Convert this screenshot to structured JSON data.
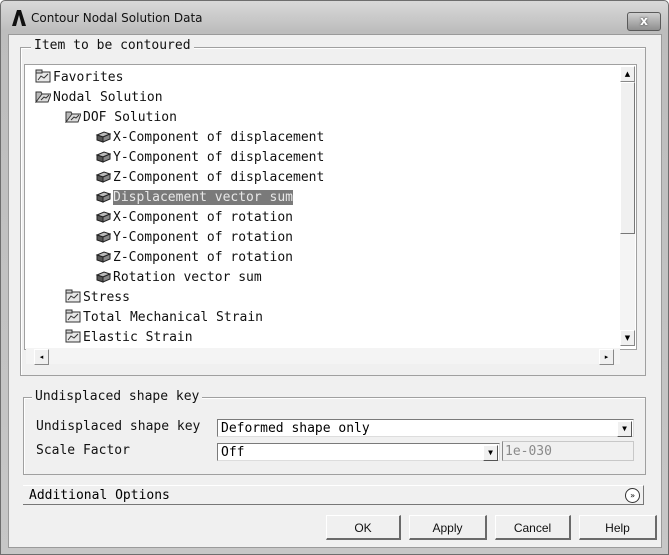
{
  "window": {
    "title": "Contour Nodal Solution Data",
    "close_label": "x"
  },
  "item_group": {
    "legend": "Item to be contoured",
    "tree": [
      {
        "label": "Favorites",
        "icon": "folder-closed-icon",
        "level": 0,
        "selected": false
      },
      {
        "label": "Nodal Solution",
        "icon": "folder-open-icon",
        "level": 0,
        "selected": false
      },
      {
        "label": "DOF Solution",
        "icon": "folder-open-icon",
        "level": 1,
        "selected": false
      },
      {
        "label": "X-Component of displacement",
        "icon": "result-cube-icon",
        "level": 2,
        "selected": false
      },
      {
        "label": "Y-Component of displacement",
        "icon": "result-cube-icon",
        "level": 2,
        "selected": false
      },
      {
        "label": "Z-Component of displacement",
        "icon": "result-cube-icon",
        "level": 2,
        "selected": false
      },
      {
        "label": "Displacement vector sum",
        "icon": "result-cube-icon",
        "level": 2,
        "selected": true
      },
      {
        "label": "X-Component of rotation",
        "icon": "result-cube-icon",
        "level": 2,
        "selected": false
      },
      {
        "label": "Y-Component of rotation",
        "icon": "result-cube-icon",
        "level": 2,
        "selected": false
      },
      {
        "label": "Z-Component of rotation",
        "icon": "result-cube-icon",
        "level": 2,
        "selected": false
      },
      {
        "label": "Rotation vector sum",
        "icon": "result-cube-icon",
        "level": 2,
        "selected": false
      },
      {
        "label": "Stress",
        "icon": "folder-closed-icon",
        "level": 1,
        "selected": false
      },
      {
        "label": "Total Mechanical Strain",
        "icon": "folder-closed-icon",
        "level": 1,
        "selected": false
      },
      {
        "label": "Elastic Strain",
        "icon": "folder-closed-icon",
        "level": 1,
        "selected": false
      }
    ]
  },
  "shape_group": {
    "legend": "Undisplaced shape key",
    "shape_key_label": "Undisplaced shape key",
    "shape_key_value": "Deformed shape only",
    "scale_factor_label": "Scale Factor",
    "scale_factor_value": "Off",
    "scale_factor_number": "1e-030"
  },
  "additional_options": {
    "label": "Additional Options"
  },
  "buttons": {
    "ok": "OK",
    "apply": "Apply",
    "cancel": "Cancel",
    "help": "Help"
  },
  "colors": {
    "selection_bg": "#7a7a7a",
    "dialog_bg": "#f0f0f0"
  }
}
